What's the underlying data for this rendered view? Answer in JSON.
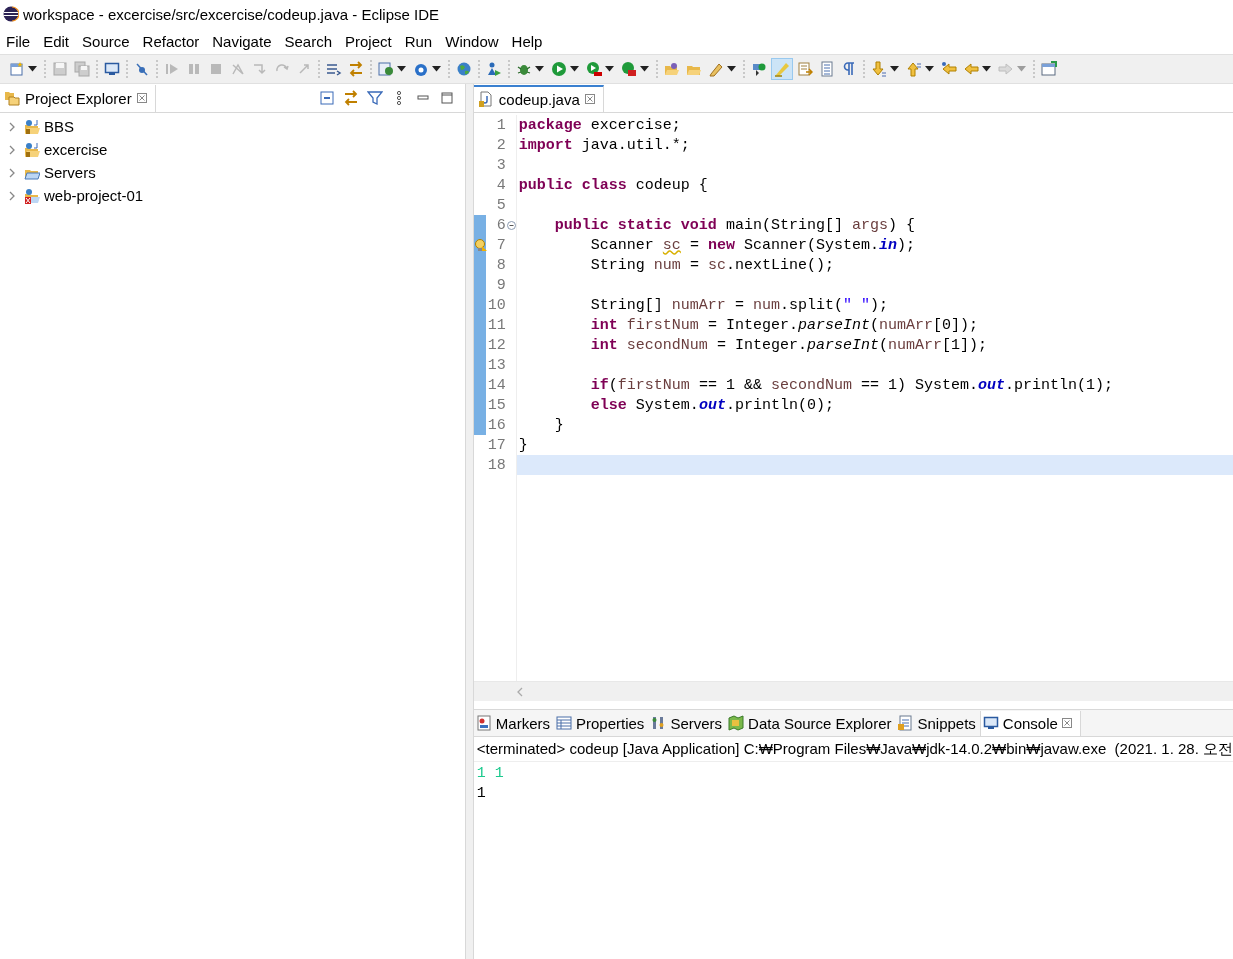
{
  "window": {
    "title": "workspace - excercise/src/excercise/codeup.java - Eclipse IDE"
  },
  "menu": [
    {
      "label": "File"
    },
    {
      "label": "Edit"
    },
    {
      "label": "Source"
    },
    {
      "label": "Refactor"
    },
    {
      "label": "Navigate"
    },
    {
      "label": "Search"
    },
    {
      "label": "Project"
    },
    {
      "label": "Run"
    },
    {
      "label": "Window"
    },
    {
      "label": "Help"
    }
  ],
  "toolbar": [
    {
      "kind": "button",
      "dropdown": true,
      "disabled": false,
      "pressed": false
    },
    {
      "kind": "separator"
    },
    {
      "kind": "button",
      "dropdown": false,
      "disabled": true,
      "pressed": false
    },
    {
      "kind": "button",
      "dropdown": false,
      "disabled": true,
      "pressed": false
    },
    {
      "kind": "separator"
    },
    {
      "kind": "button",
      "dropdown": false,
      "disabled": false,
      "pressed": false
    },
    {
      "kind": "separator"
    },
    {
      "kind": "button",
      "dropdown": false,
      "disabled": false,
      "pressed": false
    },
    {
      "kind": "separator"
    },
    {
      "kind": "button",
      "dropdown": false,
      "disabled": true,
      "pressed": false
    },
    {
      "kind": "button",
      "dropdown": false,
      "disabled": true,
      "pressed": false
    },
    {
      "kind": "button",
      "dropdown": false,
      "disabled": true,
      "pressed": false
    },
    {
      "kind": "button",
      "dropdown": false,
      "disabled": true,
      "pressed": false
    },
    {
      "kind": "button",
      "dropdown": false,
      "disabled": true,
      "pressed": false
    },
    {
      "kind": "button",
      "dropdown": false,
      "disabled": true,
      "pressed": false
    },
    {
      "kind": "button",
      "dropdown": false,
      "disabled": true,
      "pressed": false
    },
    {
      "kind": "separator"
    },
    {
      "kind": "button",
      "dropdown": false,
      "disabled": false,
      "pressed": false
    },
    {
      "kind": "button",
      "dropdown": false,
      "disabled": false,
      "pressed": false
    },
    {
      "kind": "separator"
    },
    {
      "kind": "button",
      "dropdown": true,
      "disabled": false,
      "pressed": false
    },
    {
      "kind": "button",
      "dropdown": true,
      "disabled": false,
      "pressed": false
    },
    {
      "kind": "separator"
    },
    {
      "kind": "button",
      "dropdown": false,
      "disabled": false,
      "pressed": false
    },
    {
      "kind": "separator"
    },
    {
      "kind": "button",
      "dropdown": false,
      "disabled": false,
      "pressed": false
    },
    {
      "kind": "separator"
    },
    {
      "kind": "button",
      "dropdown": true,
      "disabled": false,
      "pressed": false
    },
    {
      "kind": "button",
      "dropdown": true,
      "disabled": false,
      "pressed": false
    },
    {
      "kind": "button",
      "dropdown": true,
      "disabled": false,
      "pressed": false
    },
    {
      "kind": "button",
      "dropdown": true,
      "disabled": false,
      "pressed": false
    },
    {
      "kind": "separator"
    },
    {
      "kind": "button",
      "dropdown": false,
      "disabled": false,
      "pressed": false
    },
    {
      "kind": "button",
      "dropdown": false,
      "disabled": false,
      "pressed": false
    },
    {
      "kind": "button",
      "dropdown": true,
      "disabled": false,
      "pressed": false
    },
    {
      "kind": "separator"
    },
    {
      "kind": "button",
      "dropdown": false,
      "disabled": false,
      "pressed": false
    },
    {
      "kind": "button",
      "dropdown": false,
      "disabled": false,
      "pressed": true
    },
    {
      "kind": "button",
      "dropdown": false,
      "disabled": false,
      "pressed": false
    },
    {
      "kind": "button",
      "dropdown": false,
      "disabled": false,
      "pressed": false
    },
    {
      "kind": "button",
      "dropdown": false,
      "disabled": false,
      "pressed": false
    },
    {
      "kind": "separator"
    },
    {
      "kind": "button",
      "dropdown": true,
      "disabled": false,
      "pressed": false
    },
    {
      "kind": "button",
      "dropdown": true,
      "disabled": false,
      "pressed": false
    },
    {
      "kind": "button",
      "dropdown": false,
      "disabled": false,
      "pressed": false
    },
    {
      "kind": "button",
      "dropdown": true,
      "disabled": false,
      "pressed": false
    },
    {
      "kind": "button",
      "dropdown": true,
      "disabled": true,
      "pressed": false
    },
    {
      "kind": "separator"
    },
    {
      "kind": "button",
      "dropdown": false,
      "disabled": false,
      "pressed": false
    }
  ],
  "explorer": {
    "title": "Project Explorer",
    "projects": [
      {
        "name": "BBS",
        "kind": "java-project",
        "expanded": false
      },
      {
        "name": "excercise",
        "kind": "java-project",
        "expanded": false
      },
      {
        "name": "Servers",
        "kind": "folder",
        "expanded": false
      },
      {
        "name": "web-project-01",
        "kind": "web-project-error",
        "expanded": false
      }
    ]
  },
  "editor": {
    "tab": {
      "title": "codeup.java",
      "selected": true
    },
    "lines": [
      {
        "number": "1",
        "changed": false,
        "current": false,
        "foldable": false,
        "warning": false,
        "tokens": [
          {
            "kind": "kw",
            "t": "package"
          },
          {
            "kind": "plain",
            "t": " excercise;"
          }
        ]
      },
      {
        "number": "2",
        "changed": false,
        "current": false,
        "foldable": false,
        "warning": false,
        "tokens": [
          {
            "kind": "kw",
            "t": "import"
          },
          {
            "kind": "plain",
            "t": " java.util.*;"
          }
        ]
      },
      {
        "number": "3",
        "changed": false,
        "current": false,
        "foldable": false,
        "warning": false
      },
      {
        "number": "4",
        "changed": false,
        "current": false,
        "foldable": false,
        "warning": false,
        "tokens": [
          {
            "kind": "kw",
            "t": "public class"
          },
          {
            "kind": "plain",
            "t": " codeup {"
          }
        ]
      },
      {
        "number": "5",
        "changed": false,
        "current": false,
        "foldable": false,
        "warning": false
      },
      {
        "number": "6",
        "changed": true,
        "current": false,
        "foldable": true,
        "warning": false,
        "tokens": [
          {
            "kind": "kw",
            "t": "    public static void"
          },
          {
            "kind": "plain",
            "t": " main(String[] "
          },
          {
            "kind": "local",
            "t": "args"
          },
          {
            "kind": "plain",
            "t": ") {"
          }
        ]
      },
      {
        "number": "7",
        "changed": true,
        "current": false,
        "foldable": false,
        "warning": true,
        "tokens": [
          {
            "kind": "plain",
            "t": "        Scanner "
          },
          {
            "kind": "warnlocal",
            "t": "sc"
          },
          {
            "kind": "plain",
            "t": " = "
          },
          {
            "kind": "kw",
            "t": "new"
          },
          {
            "kind": "plain",
            "t": " Scanner(System."
          },
          {
            "kind": "field",
            "t": "in"
          },
          {
            "kind": "plain",
            "t": ");"
          }
        ]
      },
      {
        "number": "8",
        "changed": true,
        "current": false,
        "foldable": false,
        "warning": false,
        "tokens": [
          {
            "kind": "plain",
            "t": "        String "
          },
          {
            "kind": "local",
            "t": "num"
          },
          {
            "kind": "plain",
            "t": " = "
          },
          {
            "kind": "local",
            "t": "sc"
          },
          {
            "kind": "plain",
            "t": ".nextLine();"
          }
        ]
      },
      {
        "number": "9",
        "changed": true,
        "current": false,
        "foldable": false,
        "warning": false
      },
      {
        "number": "10",
        "changed": true,
        "current": false,
        "foldable": false,
        "warning": false,
        "tokens": [
          {
            "kind": "plain",
            "t": "        String[] "
          },
          {
            "kind": "local",
            "t": "numArr"
          },
          {
            "kind": "plain",
            "t": " = "
          },
          {
            "kind": "local",
            "t": "num"
          },
          {
            "kind": "plain",
            "t": ".split("
          },
          {
            "kind": "str",
            "t": "\" \""
          },
          {
            "kind": "plain",
            "t": ");"
          }
        ]
      },
      {
        "number": "11",
        "changed": true,
        "current": false,
        "foldable": false,
        "warning": false,
        "tokens": [
          {
            "kind": "kw",
            "t": "        int"
          },
          {
            "kind": "local",
            "t": " firstNum"
          },
          {
            "kind": "plain",
            "t": " = Integer."
          },
          {
            "kind": "smethod",
            "t": "parseInt"
          },
          {
            "kind": "plain",
            "t": "("
          },
          {
            "kind": "local",
            "t": "numArr"
          },
          {
            "kind": "plain",
            "t": "[0]);"
          }
        ]
      },
      {
        "number": "12",
        "changed": true,
        "current": false,
        "foldable": false,
        "warning": false,
        "tokens": [
          {
            "kind": "kw",
            "t": "        int"
          },
          {
            "kind": "local",
            "t": " secondNum"
          },
          {
            "kind": "plain",
            "t": " = Integer."
          },
          {
            "kind": "smethod",
            "t": "parseInt"
          },
          {
            "kind": "plain",
            "t": "("
          },
          {
            "kind": "local",
            "t": "numArr"
          },
          {
            "kind": "plain",
            "t": "[1]);"
          }
        ]
      },
      {
        "number": "13",
        "changed": true,
        "current": false,
        "foldable": false,
        "warning": false
      },
      {
        "number": "14",
        "changed": true,
        "current": false,
        "foldable": false,
        "warning": false,
        "tokens": [
          {
            "kind": "kw",
            "t": "        if"
          },
          {
            "kind": "plain",
            "t": "("
          },
          {
            "kind": "local",
            "t": "firstNum"
          },
          {
            "kind": "plain",
            "t": " == 1 && "
          },
          {
            "kind": "local",
            "t": "secondNum"
          },
          {
            "kind": "plain",
            "t": " == 1) System."
          },
          {
            "kind": "field",
            "t": "out"
          },
          {
            "kind": "plain",
            "t": ".println(1);"
          }
        ]
      },
      {
        "number": "15",
        "changed": true,
        "current": false,
        "foldable": false,
        "warning": false,
        "tokens": [
          {
            "kind": "kw",
            "t": "        else"
          },
          {
            "kind": "plain",
            "t": " System."
          },
          {
            "kind": "field",
            "t": "out"
          },
          {
            "kind": "plain",
            "t": ".println(0);"
          }
        ]
      },
      {
        "number": "16",
        "changed": true,
        "current": false,
        "foldable": false,
        "warning": false,
        "tokens": [
          {
            "kind": "plain",
            "t": "    }"
          }
        ]
      },
      {
        "number": "17",
        "changed": false,
        "current": false,
        "foldable": false,
        "warning": false,
        "tokens": [
          {
            "kind": "plain",
            "t": "}"
          }
        ]
      },
      {
        "number": "18",
        "changed": false,
        "current": true,
        "foldable": false,
        "warning": false
      }
    ]
  },
  "bottom": {
    "views": [
      {
        "title": "Markers",
        "selected": false
      },
      {
        "title": "Properties",
        "selected": false
      },
      {
        "title": "Servers",
        "selected": false
      },
      {
        "title": "Data Source Explorer",
        "selected": false
      },
      {
        "title": "Snippets",
        "selected": false
      },
      {
        "title": "Console",
        "selected": true
      }
    ],
    "console_header": "<terminated> codeup [Java Application] C:₩Program Files₩Java₩jdk-14.0.2₩bin₩javaw.exe  (2021. 1. 28. 오전",
    "output": [
      {
        "text": "1 1",
        "kind": "input"
      },
      {
        "text": "1",
        "kind": "output"
      }
    ]
  }
}
